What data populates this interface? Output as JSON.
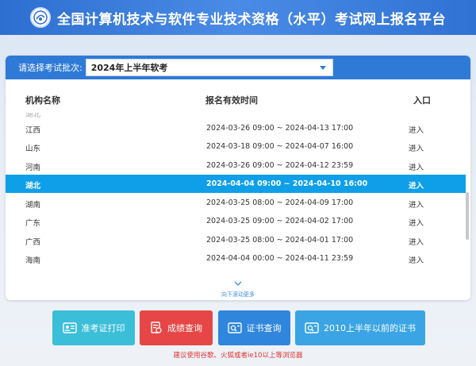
{
  "header": {
    "title": "全国计算机技术与软件专业技术资格（水平）考试网上报名平台"
  },
  "batch": {
    "label": "请选择考试批次:",
    "value": "2024年上半年软考"
  },
  "table": {
    "columns": [
      "机构名称",
      "报名有效时间",
      "入口"
    ],
    "partial_row": {
      "name": "湖北",
      "time": "",
      "entry": ""
    },
    "rows": [
      {
        "name": "江西",
        "time": "2024-03-26 09:00 ~ 2024-04-13 17:00",
        "entry": "进入"
      },
      {
        "name": "山东",
        "time": "2024-03-18 09:00 ~ 2024-04-07 16:00",
        "entry": "进入"
      },
      {
        "name": "河南",
        "time": "2024-03-26 09:00 ~ 2024-04-12 23:59",
        "entry": "进入"
      },
      {
        "name": "湖北",
        "time": "2024-04-04 09:00 ~ 2024-04-10 16:00",
        "entry": "进入"
      },
      {
        "name": "湖南",
        "time": "2024-03-25 08:00 ~ 2024-04-09 17:00",
        "entry": "进入"
      },
      {
        "name": "广东",
        "time": "2024-03-25 09:00 ~ 2024-04-02 17:00",
        "entry": "进入"
      },
      {
        "name": "广西",
        "time": "2024-03-25 08:00 ~ 2024-04-01 17:00",
        "entry": "进入"
      },
      {
        "name": "海南",
        "time": "2024-04-04 00:00 ~ 2024-04-11 23:59",
        "entry": "进入"
      }
    ]
  },
  "scroll_hint": "向下滚动更多",
  "buttons": {
    "admit_ticket": "准考证打印",
    "score_query": "成绩查询",
    "certificate_query": "证书查询",
    "old_certificate": "2010上半年以前的证书"
  },
  "footer_note": "建议使用谷歌、火狐或者ie10以上等浏览器",
  "colors": {
    "header": "#2d6fd0",
    "active_row": "#0f9fe8",
    "warning": "#e0302f"
  }
}
